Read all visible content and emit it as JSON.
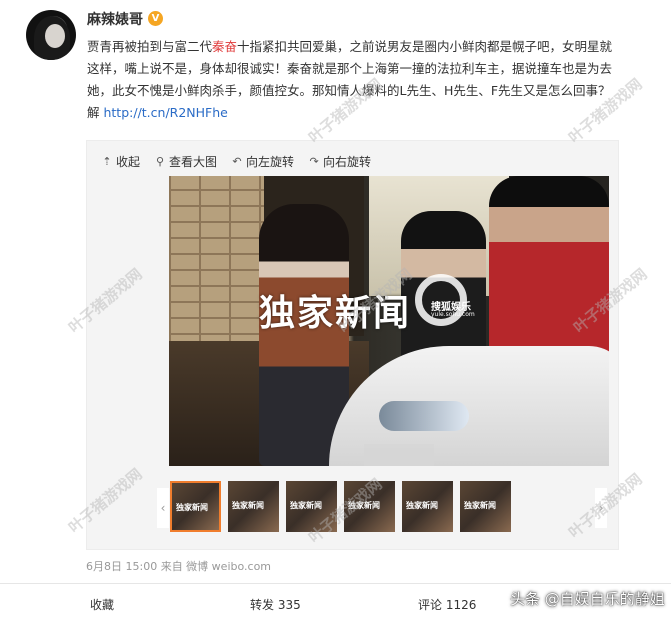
{
  "post": {
    "author": "麻辣婊哥",
    "vip_badge": "V",
    "lines": [
      [
        "贾青再被拍到与富二代",
        "秦奋",
        "十指紧扣共回爱巢，之前说男友是圈内小鲜肉都是幌子吧，女明星就"
      ],
      [
        "这样，嘴上说不是，身体却很诚实！秦奋就是那个上海第一撞的法拉利车主，据说撞车也是为去"
      ],
      [
        "她，此女不愧是小鲜肉杀手，颜值控女。那知情人爆料的L先生、H先生、F先生又是怎么回事？"
      ],
      [
        "解 ",
        "http://t.cn/R2NHFhe"
      ]
    ]
  },
  "toolbar": {
    "collapse": "收起",
    "view_large": "查看大图",
    "rotate_left": "向左旋转",
    "rotate_right": "向右旋转"
  },
  "photo": {
    "exclusive": "独家新闻",
    "brand": "搜狐娱乐",
    "brand_url": "yule.sohu.com"
  },
  "thumbnails": [
    "独家新闻",
    "独家新闻",
    "独家新闻",
    "独家新闻",
    "独家新闻",
    "独家新闻"
  ],
  "meta": "6月8日 15:00 来自 微博 weibo.com",
  "actions": {
    "favorite": "收藏",
    "repost": "转发 335",
    "comment": "评论 1126"
  },
  "watermarks": [
    "叶子猪游戏网",
    "叶子猪游戏网",
    "叶子猪游戏网",
    "叶子猪游戏网",
    "叶子猪游戏网",
    "叶子猪游戏网",
    "叶子猪游戏网",
    "叶子猪游戏网"
  ],
  "source_mark": "头条 @自娱自乐的静姐",
  "colors": {
    "highlight": "#e03c3c",
    "link": "#2a6bc6",
    "thumb_active": "#f07d2d"
  }
}
